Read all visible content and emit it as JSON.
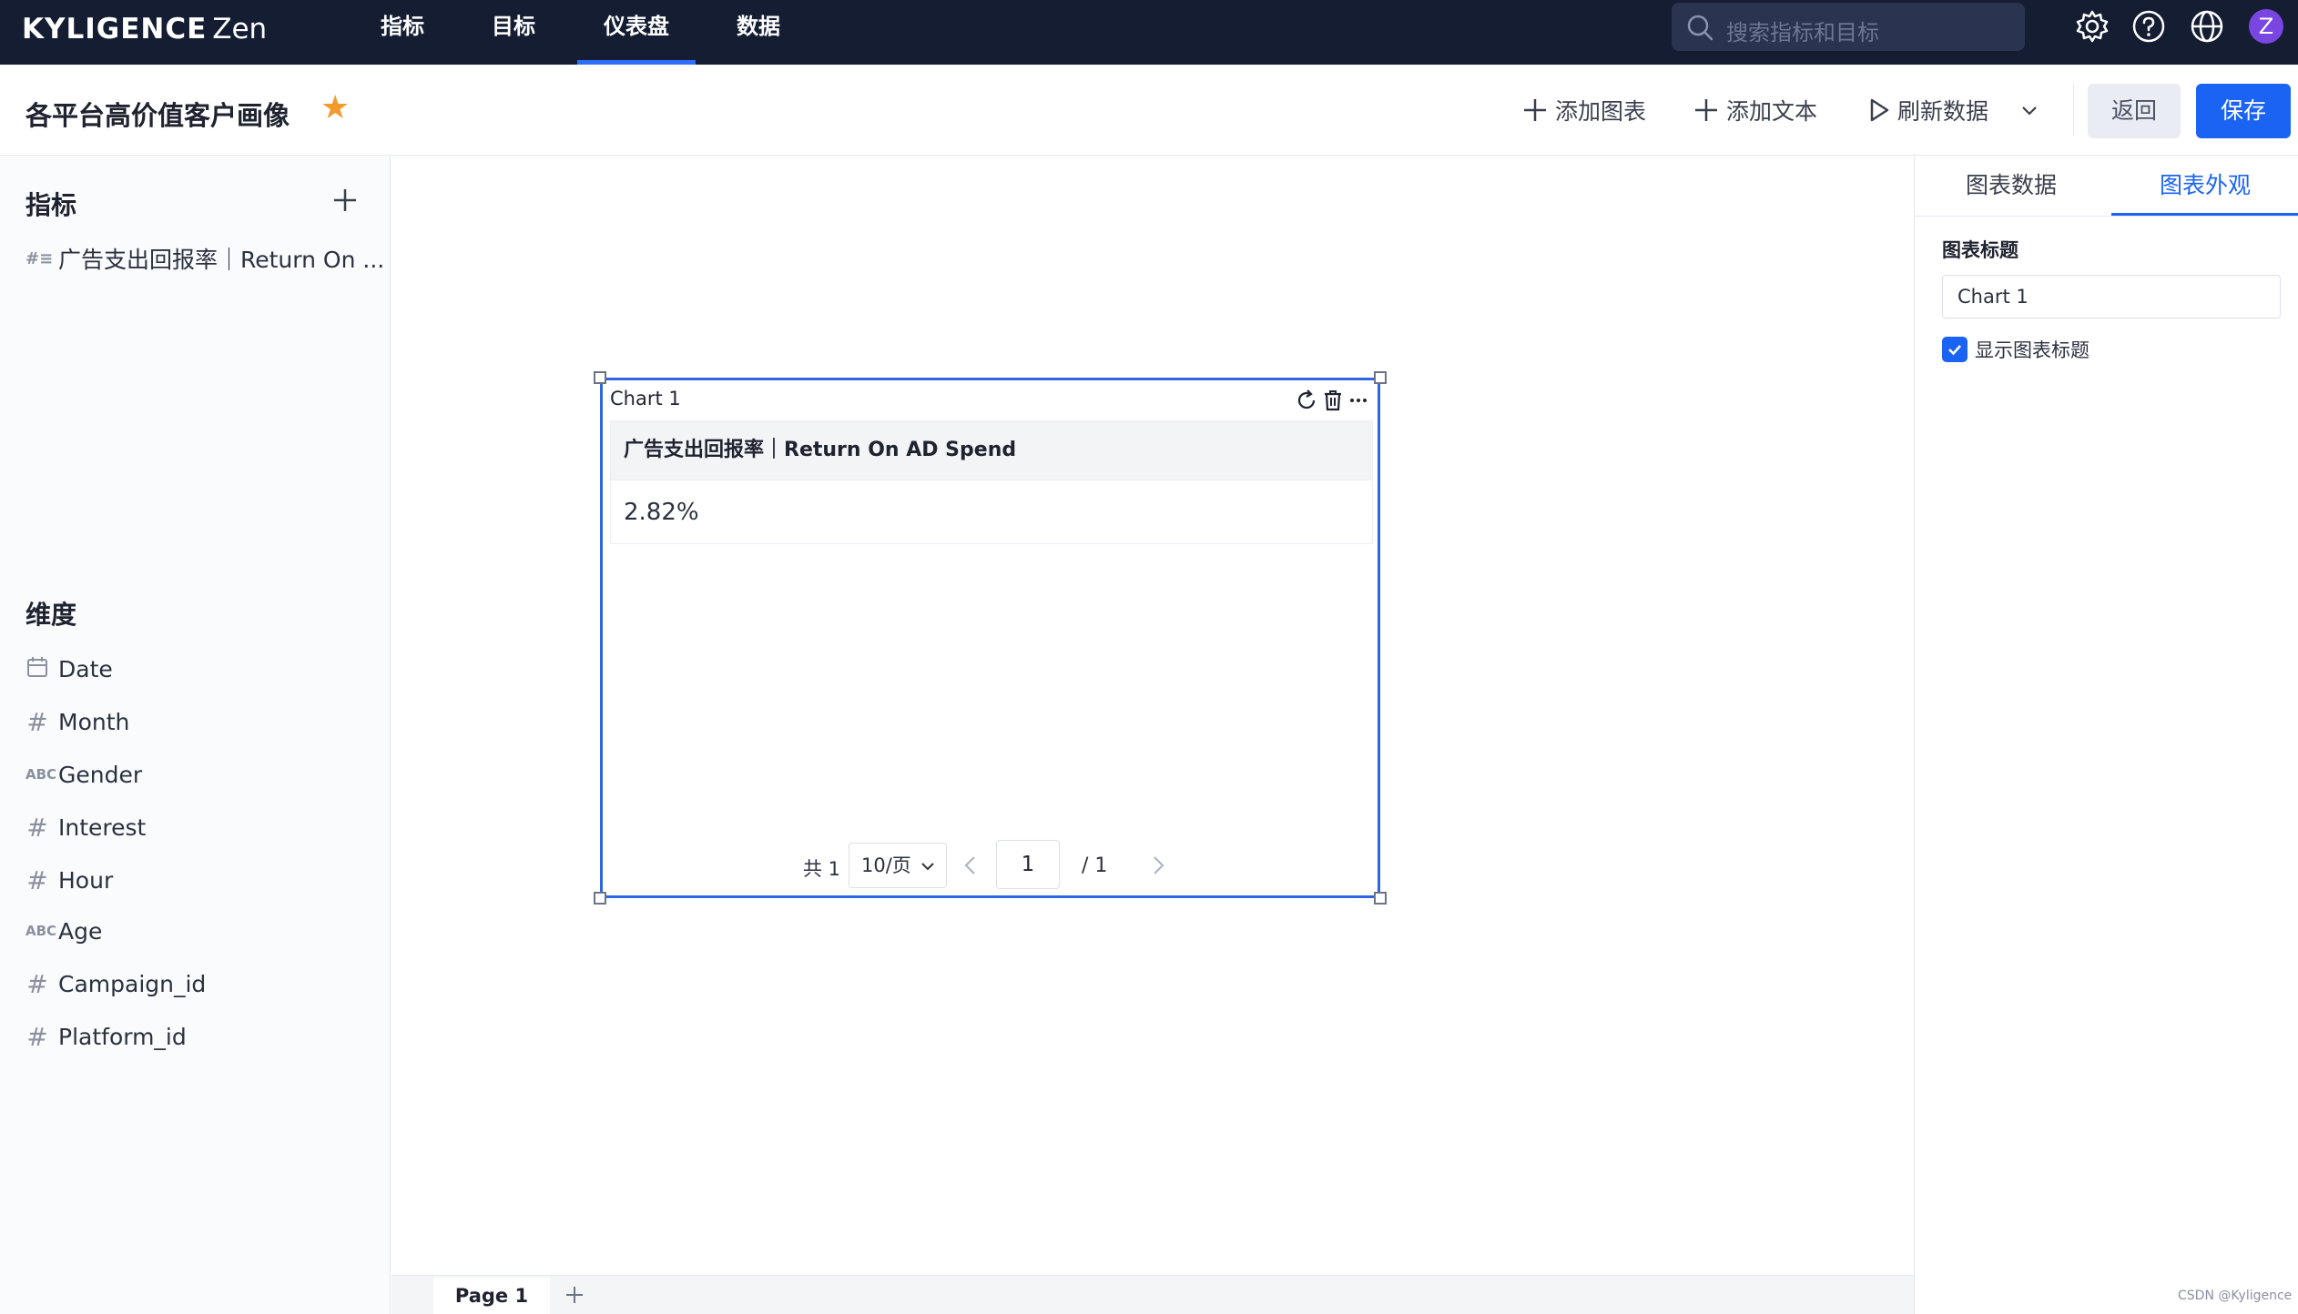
{
  "app": {
    "logo_main": "KYLIGENCE",
    "logo_sub": "Zen"
  },
  "nav": {
    "items": [
      {
        "label": "指标"
      },
      {
        "label": "目标"
      },
      {
        "label": "仪表盘"
      },
      {
        "label": "数据"
      }
    ],
    "active_index": 2,
    "search_placeholder": "搜索指标和目标",
    "avatar_letter": "Z"
  },
  "toolbar": {
    "title": "各平台高价值客户画像",
    "favorite_icon": "star-icon",
    "add_chart": "添加图表",
    "add_text": "添加文本",
    "refresh": "刷新数据",
    "back": "返回",
    "save": "保存"
  },
  "sidebar": {
    "metrics_title": "指标",
    "metrics": [
      {
        "label": "广告支出回报率｜Return On ...",
        "icon": "metric-icon"
      }
    ],
    "dimensions_title": "维度",
    "dimensions": [
      {
        "label": "Date",
        "type": "date"
      },
      {
        "label": "Month",
        "type": "number"
      },
      {
        "label": "Gender",
        "type": "text"
      },
      {
        "label": "Interest",
        "type": "number"
      },
      {
        "label": "Hour",
        "type": "number"
      },
      {
        "label": "Age",
        "type": "text"
      },
      {
        "label": "Campaign_id",
        "type": "number"
      },
      {
        "label": "Platform_id",
        "type": "number"
      }
    ],
    "type_glyph_text": "ABC"
  },
  "chart": {
    "title": "Chart 1",
    "column_header": "广告支出回报率｜Return On AD Spend",
    "value": "2.82%",
    "pager": {
      "total": "共 1",
      "page_size": "10/页",
      "current_page": "1",
      "of_pages": "/  1"
    }
  },
  "pages": {
    "tabs": [
      {
        "label": "Page 1"
      }
    ]
  },
  "right_panel": {
    "tab_data": "图表数据",
    "tab_style": "图表外观",
    "active_tab": "图表外观",
    "title_label": "图表标题",
    "title_value": "Chart 1",
    "show_title_label": "显示图表标题",
    "show_title_checked": true
  },
  "watermark": "CSDN @Kyligence",
  "colors": {
    "nav_bg": "#151d33",
    "accent": "#1a63f3",
    "star": "#f29a2e",
    "avatar": "#7a46e2"
  }
}
